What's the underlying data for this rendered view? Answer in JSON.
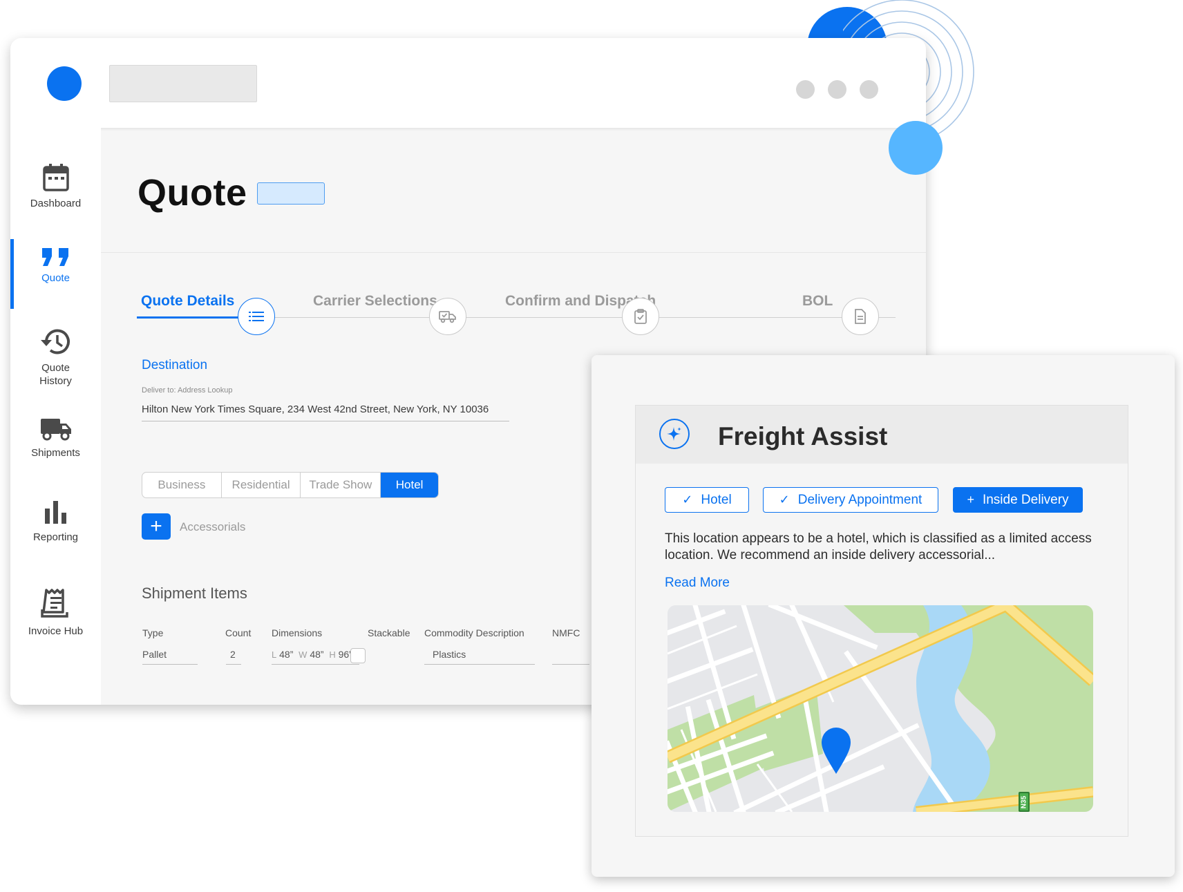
{
  "sidebar": {
    "items": [
      {
        "label": "Dashboard",
        "icon": "calendar-icon"
      },
      {
        "label": "Quote",
        "icon": "quote-icon"
      },
      {
        "label": "Quote History",
        "icon": "history-icon"
      },
      {
        "label": "Shipments",
        "icon": "truck-icon"
      },
      {
        "label": "Reporting",
        "icon": "bar-chart-icon"
      },
      {
        "label": "Invoice Hub",
        "icon": "invoice-icon"
      }
    ],
    "active": "Quote"
  },
  "page": {
    "title": "Quote"
  },
  "steps": [
    {
      "label": "Quote Details",
      "icon": "list-icon",
      "active": true
    },
    {
      "label": "Carrier Selections",
      "icon": "truck-check-icon",
      "active": false
    },
    {
      "label": "Confirm and Dispatch",
      "icon": "clipboard-check-icon",
      "active": false
    },
    {
      "label": "BOL",
      "icon": "document-icon",
      "active": false
    }
  ],
  "destination": {
    "heading": "Destination",
    "field_label": "Deliver to: Address Lookup",
    "address": "Hilton New York Times Square, 234 West 42nd Street, New York, NY 10036"
  },
  "location_types": {
    "options": [
      "Business",
      "Residential",
      "Trade Show",
      "Hotel"
    ],
    "selected": "Hotel"
  },
  "accessorials": {
    "add_label": "+",
    "label": "Accessorials"
  },
  "shipment_items": {
    "title": "Shipment Items",
    "columns": [
      "Type",
      "Count",
      "Dimensions",
      "Stackable",
      "Commodity Description",
      "NMFC"
    ],
    "rows": [
      {
        "type": "Pallet",
        "count": "2",
        "dim_l_key": "L",
        "dim_l": "48”",
        "dim_w_key": "W",
        "dim_w": "48”",
        "dim_h_key": "H",
        "dim_h": "96”",
        "stackable": false,
        "commodity": "Plastics",
        "nmfc": ""
      }
    ]
  },
  "assist": {
    "title": "Freight Assist",
    "icon": "sparkle-icon",
    "tags": [
      {
        "label": "Hotel",
        "glyph": "✓",
        "style": "outline"
      },
      {
        "label": "Delivery Appointment",
        "glyph": "✓",
        "style": "outline"
      },
      {
        "label": "Inside Delivery",
        "glyph": "+",
        "style": "solid"
      }
    ],
    "description": "This location appears to be a hotel, which is classified as a limited access location. We recommend an inside delivery accessorial...",
    "read_more": "Read More",
    "map": {
      "highway_label": "N35",
      "pin_icon": "map-pin-icon"
    }
  },
  "colors": {
    "accent": "#0a72f0",
    "accent_light": "#56b6ff",
    "chip_fill": "#d6eafe",
    "road_major": "#fbe38c",
    "park": "#bfdfa6",
    "water": "#a9d8f6"
  }
}
